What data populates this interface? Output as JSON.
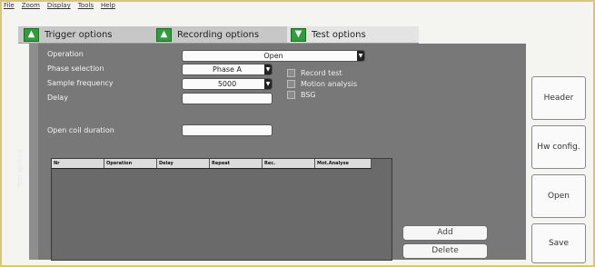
{
  "menu": [
    "File",
    "Zoom",
    "Display",
    "Tools",
    "Help"
  ],
  "tabs": [
    {
      "label": "Trigger options",
      "icon": "up-arrow-icon",
      "active": false
    },
    {
      "label": "Recording options",
      "icon": "up-arrow-icon",
      "active": false
    },
    {
      "label": "Test options",
      "icon": "down-arrow-icon",
      "active": true
    }
  ],
  "side_label": "Test options",
  "form": {
    "operation_label": "Operation",
    "operation_value": "Open",
    "phase_label": "Phase selection",
    "phase_value": "Phase A",
    "frequency_label": "Sample frequency",
    "frequency_value": "5000",
    "delay_label": "Delay",
    "delay_value": "",
    "coil_label": "Open coil duration",
    "coil_value": ""
  },
  "checkboxes": [
    "Record test",
    "Motion analysis",
    "BSG"
  ],
  "table": {
    "columns": [
      "Nr",
      "Operation",
      "Delay",
      "Repeat",
      "Rec.",
      "Mot.Analyse"
    ]
  },
  "buttons": {
    "add": "Add",
    "delete": "Delete"
  },
  "right_buttons": [
    "Header",
    "Hw config.",
    "Open",
    "Save"
  ],
  "colors": {
    "accent_green": "#2f9d3b",
    "panel_gray": "#787878"
  }
}
